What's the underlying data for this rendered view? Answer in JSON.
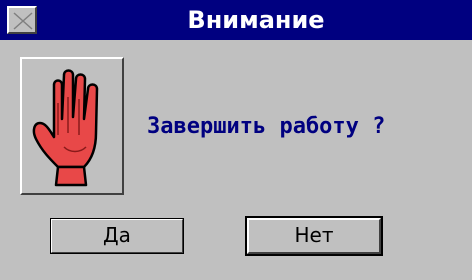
{
  "window": {
    "title": "Внимание",
    "close_icon": "close-icon"
  },
  "dialog": {
    "icon": "stop-hand-icon",
    "message": "Завершить работу ?"
  },
  "buttons": {
    "yes_label": "Да",
    "no_label": "Нет"
  },
  "colors": {
    "titlebar": "#000080",
    "message_text": "#000080",
    "background": "#c0c0c0",
    "hand": "#e84848"
  }
}
